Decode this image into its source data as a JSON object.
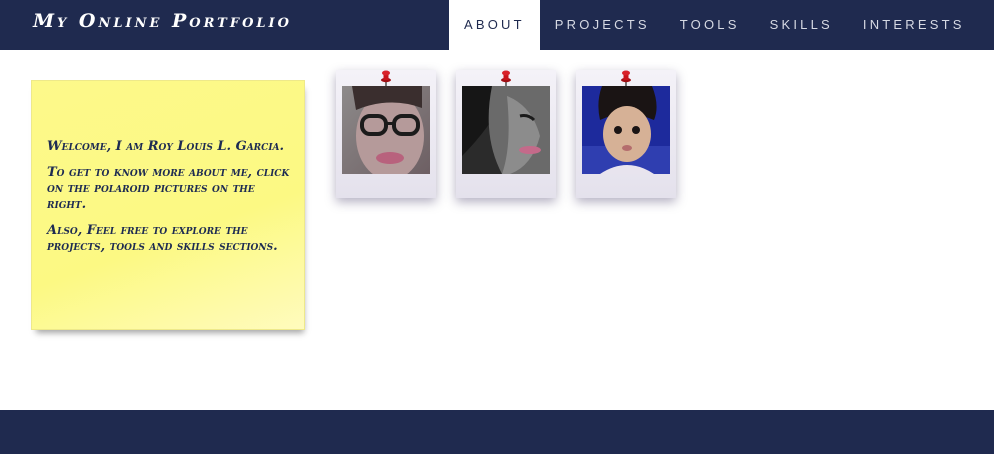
{
  "header": {
    "brand": "My Online Portfolio",
    "nav": [
      {
        "label": "About",
        "active": true
      },
      {
        "label": "Projects",
        "active": false
      },
      {
        "label": "Tools",
        "active": false
      },
      {
        "label": "Skills",
        "active": false
      },
      {
        "label": "Interests",
        "active": false
      }
    ]
  },
  "note": {
    "paragraphs": [
      "Welcome, I am Roy Louis L. Garcia.",
      "To get to know more about me, click on the polaroid pictures on the right.",
      "Also, Feel free to explore the projects, tools and skills sections."
    ]
  },
  "polaroids": [
    {
      "icon": "pushpin-icon",
      "photo": "portrait-with-glasses"
    },
    {
      "icon": "pushpin-icon",
      "photo": "portrait-side-face"
    },
    {
      "icon": "pushpin-icon",
      "photo": "childhood-portrait"
    }
  ],
  "colors": {
    "navbar": "#1f2a4f",
    "note": "#fdf98a",
    "note_text": "#1d2b52",
    "pin": "#c8141b"
  }
}
